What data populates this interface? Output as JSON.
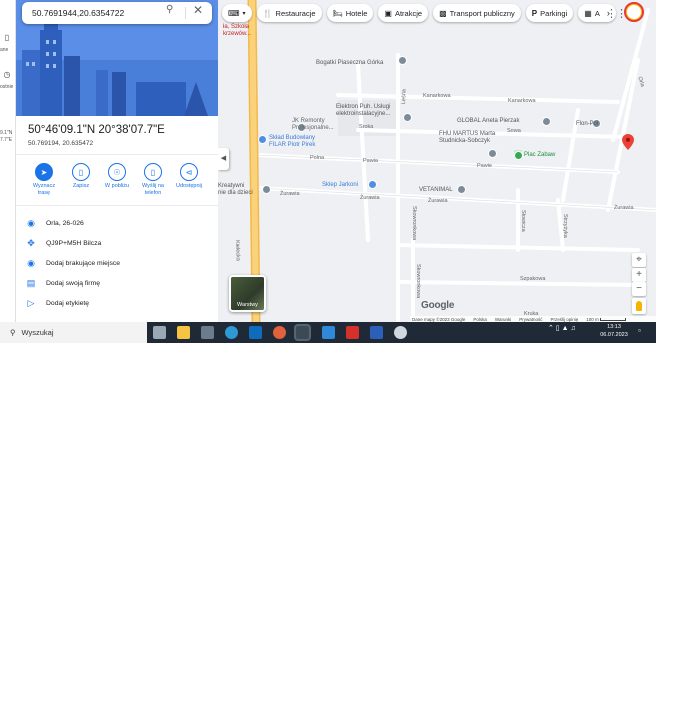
{
  "window": {
    "left_rail": {
      "items": [
        {
          "icon": "bookmark-icon"
        },
        {
          "icon": "history-icon"
        }
      ],
      "label_1": "ane",
      "label_2": "ostnie",
      "coords_snippet": "9.1\"N\n7.7\"E"
    },
    "search": {
      "value": "50.7691944,20.6354722"
    },
    "chips": [
      {
        "label": "",
        "icon": "keyboard-icon"
      },
      {
        "label": "Restauracje",
        "icon": "fork-knife-icon"
      },
      {
        "label": "Hotele",
        "icon": "bed-icon"
      },
      {
        "label": "Atrakcje",
        "icon": "camera-icon"
      },
      {
        "label": "Transport publiczny",
        "icon": "bus-icon"
      },
      {
        "label": "Parkingi",
        "icon": "parking-icon"
      },
      {
        "label": "A",
        "icon": "pharmacy-icon"
      }
    ],
    "chips_next": "›",
    "place": {
      "title": "50°46'09.1\"N 20°38'07.7\"E",
      "subtitle": "50.769194, 20.635472",
      "actions": [
        {
          "label": "Wyznacz trasę",
          "icon": "directions-icon"
        },
        {
          "label": "Zapisz",
          "icon": "bookmark-icon"
        },
        {
          "label": "W pobliżu",
          "icon": "nearby-icon"
        },
        {
          "label": "Wyślij na telefon",
          "icon": "phone-icon"
        },
        {
          "label": "Udostępnij",
          "icon": "share-icon"
        }
      ],
      "info": [
        {
          "text": "Orla, 26-026",
          "icon": "pin-icon"
        },
        {
          "text": "QJ9P+M5H Bilcza",
          "icon": "plus-code-icon"
        },
        {
          "text": "Dodaj brakujące miejsce",
          "icon": "add-place-icon"
        },
        {
          "text": "Dodaj swoją firmę",
          "icon": "store-icon"
        },
        {
          "text": "Dodaj etykietę",
          "icon": "label-icon"
        }
      ]
    },
    "map": {
      "labels": {
        "top_school": "ła, Szkoła\nkrzewów...",
        "bogatki": "Bogatki Piaseczna Górka",
        "kanarkowa1": "Kanarkowa",
        "kanarkowa2": "Kanarkowa",
        "elektron": "Elektron Puh. Usługi\nelektroinstalacyjne...",
        "jk": "JK Remonty\nProfesjonalne...",
        "skladbud": "Skład Budowlany\nFILAR Piotr Pirek",
        "global": "GLOBAL Aneta Pierzak",
        "fhu": "FHU MARTUS Marta\nStudnicka-Sobczyk",
        "flon": "Flon-Pol",
        "plac": "Plac Zabaw",
        "sowa": "Sowa",
        "sroka": "Sroka",
        "pawia": "Pawia",
        "polna": "Polna",
        "pawie": "Pawie",
        "sklep": "Sklep Jarkoni",
        "vetanimal": "VETANIMAL",
        "zurawia1": "Żurawia",
        "zurawia2": "Żurawia",
        "zurawia3": "Żurawia",
        "zurawia4": "Żurawia",
        "kreatywni": "Kreatywni\nnie dla dzieci",
        "kielecka": "Kielecka",
        "skowronkowa1": "Skowronkowa",
        "skowronkowa2": "Skowronkowa",
        "szpakowa": "Szpakowa",
        "slowicza": "Słowicza",
        "strzyzyk": "Strzyżyka",
        "kruka": "Kruka",
        "orla": "Orla",
        "leśna": "Leśna"
      },
      "layers_label": "Warstwy",
      "google": "Google",
      "footer": [
        "Dane mapy ©2023 Google",
        "Polska",
        "Warunki",
        "Prywatność",
        "Prześlij opinię",
        "100 m"
      ]
    },
    "taskbar": {
      "search_label": "Wyszukaj",
      "time": "13:13",
      "date": "06.07.2023",
      "apps": [
        "task-view-icon",
        "file-explorer-icon",
        "calculator-icon",
        "edge-icon",
        "outlook-icon",
        "paint-icon",
        "chrome-icon",
        "mail-icon",
        "acrobat-icon",
        "word-icon",
        "sync-icon"
      ]
    },
    "colors": {
      "accent": "#1a73e8",
      "hero": "#5b8ee6",
      "pin": "#ea4335",
      "road": "#f8c967",
      "taskbar": "#1f2a36"
    }
  }
}
